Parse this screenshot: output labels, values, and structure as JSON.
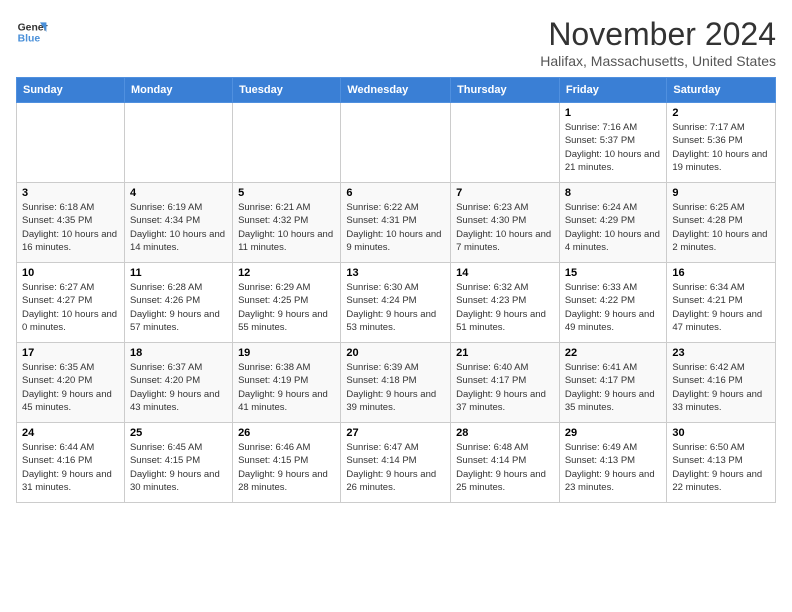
{
  "logo": {
    "line1": "General",
    "line2": "Blue"
  },
  "title": "November 2024",
  "location": "Halifax, Massachusetts, United States",
  "days_of_week": [
    "Sunday",
    "Monday",
    "Tuesday",
    "Wednesday",
    "Thursday",
    "Friday",
    "Saturday"
  ],
  "weeks": [
    [
      {
        "day": "",
        "detail": ""
      },
      {
        "day": "",
        "detail": ""
      },
      {
        "day": "",
        "detail": ""
      },
      {
        "day": "",
        "detail": ""
      },
      {
        "day": "",
        "detail": ""
      },
      {
        "day": "1",
        "detail": "Sunrise: 7:16 AM\nSunset: 5:37 PM\nDaylight: 10 hours and 21 minutes."
      },
      {
        "day": "2",
        "detail": "Sunrise: 7:17 AM\nSunset: 5:36 PM\nDaylight: 10 hours and 19 minutes."
      }
    ],
    [
      {
        "day": "3",
        "detail": "Sunrise: 6:18 AM\nSunset: 4:35 PM\nDaylight: 10 hours and 16 minutes."
      },
      {
        "day": "4",
        "detail": "Sunrise: 6:19 AM\nSunset: 4:34 PM\nDaylight: 10 hours and 14 minutes."
      },
      {
        "day": "5",
        "detail": "Sunrise: 6:21 AM\nSunset: 4:32 PM\nDaylight: 10 hours and 11 minutes."
      },
      {
        "day": "6",
        "detail": "Sunrise: 6:22 AM\nSunset: 4:31 PM\nDaylight: 10 hours and 9 minutes."
      },
      {
        "day": "7",
        "detail": "Sunrise: 6:23 AM\nSunset: 4:30 PM\nDaylight: 10 hours and 7 minutes."
      },
      {
        "day": "8",
        "detail": "Sunrise: 6:24 AM\nSunset: 4:29 PM\nDaylight: 10 hours and 4 minutes."
      },
      {
        "day": "9",
        "detail": "Sunrise: 6:25 AM\nSunset: 4:28 PM\nDaylight: 10 hours and 2 minutes."
      }
    ],
    [
      {
        "day": "10",
        "detail": "Sunrise: 6:27 AM\nSunset: 4:27 PM\nDaylight: 10 hours and 0 minutes."
      },
      {
        "day": "11",
        "detail": "Sunrise: 6:28 AM\nSunset: 4:26 PM\nDaylight: 9 hours and 57 minutes."
      },
      {
        "day": "12",
        "detail": "Sunrise: 6:29 AM\nSunset: 4:25 PM\nDaylight: 9 hours and 55 minutes."
      },
      {
        "day": "13",
        "detail": "Sunrise: 6:30 AM\nSunset: 4:24 PM\nDaylight: 9 hours and 53 minutes."
      },
      {
        "day": "14",
        "detail": "Sunrise: 6:32 AM\nSunset: 4:23 PM\nDaylight: 9 hours and 51 minutes."
      },
      {
        "day": "15",
        "detail": "Sunrise: 6:33 AM\nSunset: 4:22 PM\nDaylight: 9 hours and 49 minutes."
      },
      {
        "day": "16",
        "detail": "Sunrise: 6:34 AM\nSunset: 4:21 PM\nDaylight: 9 hours and 47 minutes."
      }
    ],
    [
      {
        "day": "17",
        "detail": "Sunrise: 6:35 AM\nSunset: 4:20 PM\nDaylight: 9 hours and 45 minutes."
      },
      {
        "day": "18",
        "detail": "Sunrise: 6:37 AM\nSunset: 4:20 PM\nDaylight: 9 hours and 43 minutes."
      },
      {
        "day": "19",
        "detail": "Sunrise: 6:38 AM\nSunset: 4:19 PM\nDaylight: 9 hours and 41 minutes."
      },
      {
        "day": "20",
        "detail": "Sunrise: 6:39 AM\nSunset: 4:18 PM\nDaylight: 9 hours and 39 minutes."
      },
      {
        "day": "21",
        "detail": "Sunrise: 6:40 AM\nSunset: 4:17 PM\nDaylight: 9 hours and 37 minutes."
      },
      {
        "day": "22",
        "detail": "Sunrise: 6:41 AM\nSunset: 4:17 PM\nDaylight: 9 hours and 35 minutes."
      },
      {
        "day": "23",
        "detail": "Sunrise: 6:42 AM\nSunset: 4:16 PM\nDaylight: 9 hours and 33 minutes."
      }
    ],
    [
      {
        "day": "24",
        "detail": "Sunrise: 6:44 AM\nSunset: 4:16 PM\nDaylight: 9 hours and 31 minutes."
      },
      {
        "day": "25",
        "detail": "Sunrise: 6:45 AM\nSunset: 4:15 PM\nDaylight: 9 hours and 30 minutes."
      },
      {
        "day": "26",
        "detail": "Sunrise: 6:46 AM\nSunset: 4:15 PM\nDaylight: 9 hours and 28 minutes."
      },
      {
        "day": "27",
        "detail": "Sunrise: 6:47 AM\nSunset: 4:14 PM\nDaylight: 9 hours and 26 minutes."
      },
      {
        "day": "28",
        "detail": "Sunrise: 6:48 AM\nSunset: 4:14 PM\nDaylight: 9 hours and 25 minutes."
      },
      {
        "day": "29",
        "detail": "Sunrise: 6:49 AM\nSunset: 4:13 PM\nDaylight: 9 hours and 23 minutes."
      },
      {
        "day": "30",
        "detail": "Sunrise: 6:50 AM\nSunset: 4:13 PM\nDaylight: 9 hours and 22 minutes."
      }
    ]
  ]
}
